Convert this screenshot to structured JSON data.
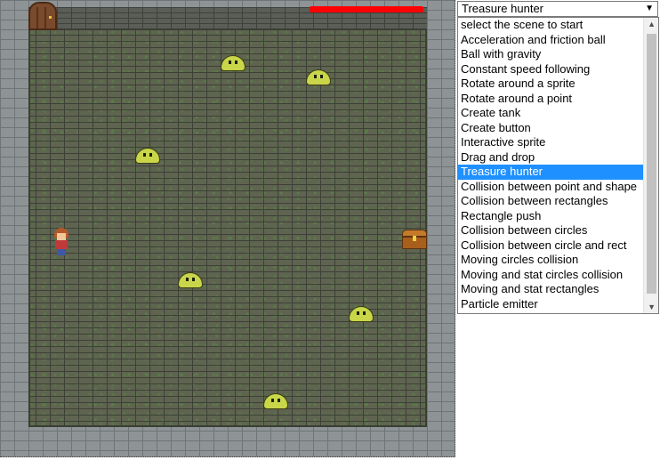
{
  "game": {
    "scene": "Treasure hunter",
    "health_fraction": 1.0
  },
  "selector": {
    "selected": "Treasure hunter",
    "dropdown_icon": "triangle-down-icon",
    "options": [
      "select the scene to start",
      "Acceleration and friction ball",
      "Ball with gravity",
      "Constant speed following",
      "Rotate around a sprite",
      "Rotate around a point",
      "Create tank",
      "Create button",
      "Interactive sprite",
      "Drag and drop",
      "Treasure hunter",
      "Collision between point and shape",
      "Collision between rectangles",
      "Rectangle push",
      "Collision between circles",
      "Collision between circle and rect",
      "Moving circles collision",
      "Moving and stat circles collision",
      "Moving and stat rectangles",
      "Particle emitter"
    ]
  },
  "colors": {
    "health": "#ff0000",
    "selection": "#1e90ff",
    "blob": "#c9d64a"
  }
}
